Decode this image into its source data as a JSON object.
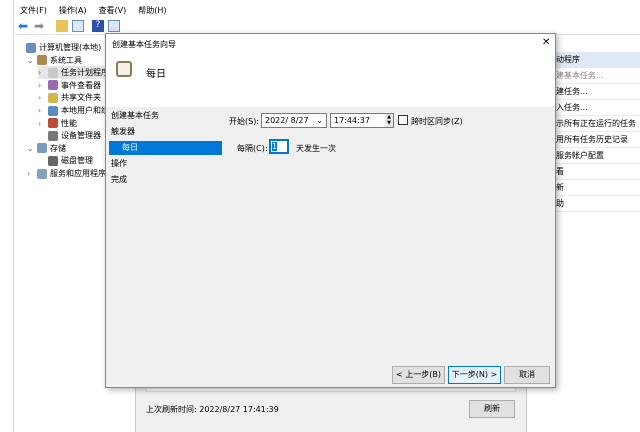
{
  "menu": [
    "文件(F)",
    "操作(A)",
    "查看(V)",
    "帮助(H)"
  ],
  "tree": [
    {
      "label": "计算机管理(本地)",
      "level": 0,
      "expander": ""
    },
    {
      "label": "系统工具",
      "level": 1,
      "expander": "⌄"
    },
    {
      "label": "任务计划程序",
      "level": 2,
      "expander": "›",
      "selected": true
    },
    {
      "label": "事件查看器",
      "level": 2,
      "expander": "›"
    },
    {
      "label": "共享文件夹",
      "level": 2,
      "expander": "›"
    },
    {
      "label": "本地用户和组",
      "level": 2,
      "expander": "›"
    },
    {
      "label": "性能",
      "level": 2,
      "expander": "›"
    },
    {
      "label": "设备管理器",
      "level": 2,
      "expander": ""
    },
    {
      "label": "存储",
      "level": 1,
      "expander": "⌄"
    },
    {
      "label": "磁盘管理",
      "level": 2,
      "expander": ""
    },
    {
      "label": "服务和应用程序",
      "level": 1,
      "expander": "›"
    }
  ],
  "actions": {
    "header": "动程序",
    "items": [
      "建基本任务...",
      "建任务...",
      "入任务...",
      "示所有正在运行的任务",
      "用所有任务历史记录",
      "服务帐户配置",
      "看",
      "新",
      "助"
    ]
  },
  "status": {
    "last_refresh": "上次刷新时间: 2022/8/27 17:41:39",
    "refresh_button": "刷新"
  },
  "dialog": {
    "title": "创建基本任务向导",
    "heading": "每日",
    "close": "✕",
    "nav": [
      "创建基本任务",
      "触发器",
      "每日",
      "操作",
      "完成"
    ],
    "start_label": "开始(S):",
    "date": "2022/  8/27",
    "time": "17:44:37",
    "sync_label": "跨时区同步(Z)",
    "sync_checked": false,
    "every_label": "每隔(C):",
    "every_value": "1",
    "every_suffix": "天发生一次",
    "back": "< 上一步(B)",
    "next": "下一步(N) >",
    "cancel": "取消"
  }
}
